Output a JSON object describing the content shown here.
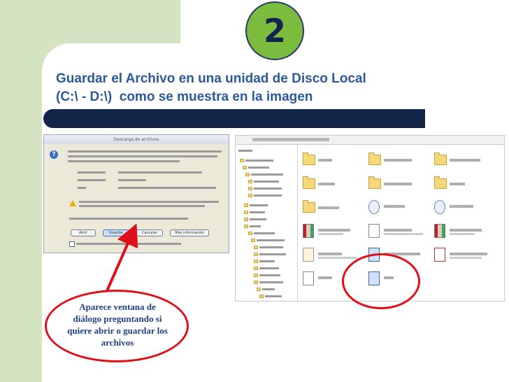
{
  "slide": {
    "number": "2",
    "title_line1": "Guardar el Archivo en una unidad de Disco Local",
    "title_line2": "(C:\\ - D:\\)  como se muestra en la imagen"
  },
  "dialog": {
    "title": "Descarga de archivos",
    "buttons": [
      "Abrir",
      "Guardar",
      "Cancelar",
      "Más información"
    ]
  },
  "callout": {
    "text": "Aparece ventana de diálogo preguntando si quiere abrir o guardar los archivos"
  },
  "colors": {
    "green": "#d4e4c2",
    "circle": "#7bbc3e",
    "title": "#2b5a9a",
    "navy": "#13264a",
    "annotation_red": "#e0101a"
  }
}
